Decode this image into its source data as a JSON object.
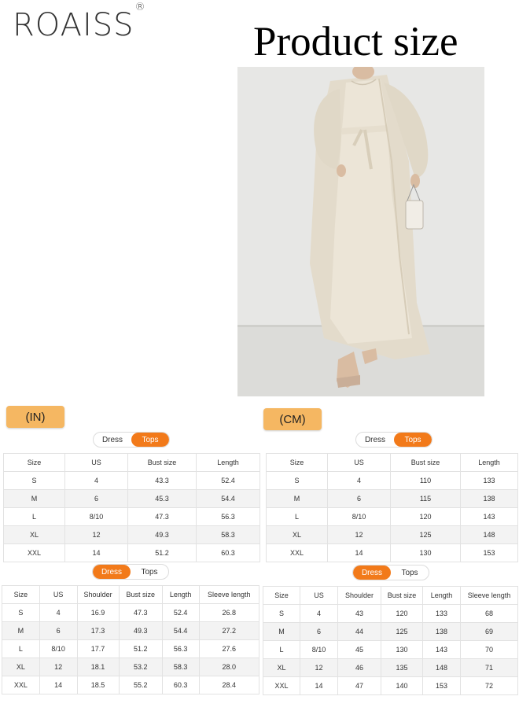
{
  "brand": {
    "name": "ROAISS",
    "mark": "®"
  },
  "title": "Product size",
  "image": {
    "alt": "model wearing long cream abaya dress with open cardigan and tie belt"
  },
  "units": {
    "in": "(IN)",
    "cm": "(CM)"
  },
  "toggle": {
    "dress": "Dress",
    "tops": "Tops"
  },
  "tops_in": {
    "headers": [
      "Size",
      "US",
      "Bust size",
      "Length"
    ],
    "rows": [
      [
        "S",
        "4",
        "43.3",
        "52.4"
      ],
      [
        "M",
        "6",
        "45.3",
        "54.4"
      ],
      [
        "L",
        "8/10",
        "47.3",
        "56.3"
      ],
      [
        "XL",
        "12",
        "49.3",
        "58.3"
      ],
      [
        "XXL",
        "14",
        "51.2",
        "60.3"
      ]
    ]
  },
  "tops_cm": {
    "headers": [
      "Size",
      "US",
      "Bust size",
      "Length"
    ],
    "rows": [
      [
        "S",
        "4",
        "110",
        "133"
      ],
      [
        "M",
        "6",
        "115",
        "138"
      ],
      [
        "L",
        "8/10",
        "120",
        "143"
      ],
      [
        "XL",
        "12",
        "125",
        "148"
      ],
      [
        "XXL",
        "14",
        "130",
        "153"
      ]
    ]
  },
  "dress_in": {
    "headers": [
      "Size",
      "US",
      "Shoulder",
      "Bust size",
      "Length",
      "Sleeve length"
    ],
    "rows": [
      [
        "S",
        "4",
        "16.9",
        "47.3",
        "52.4",
        "26.8"
      ],
      [
        "M",
        "6",
        "17.3",
        "49.3",
        "54.4",
        "27.2"
      ],
      [
        "L",
        "8/10",
        "17.7",
        "51.2",
        "56.3",
        "27.6"
      ],
      [
        "XL",
        "12",
        "18.1",
        "53.2",
        "58.3",
        "28.0"
      ],
      [
        "XXL",
        "14",
        "18.5",
        "55.2",
        "60.3",
        "28.4"
      ]
    ]
  },
  "dress_cm": {
    "headers": [
      "Size",
      "US",
      "Shoulder",
      "Bust size",
      "Length",
      "Sleeve length"
    ],
    "rows": [
      [
        "S",
        "4",
        "43",
        "120",
        "133",
        "68"
      ],
      [
        "M",
        "6",
        "44",
        "125",
        "138",
        "69"
      ],
      [
        "L",
        "8/10",
        "45",
        "130",
        "143",
        "70"
      ],
      [
        "XL",
        "12",
        "46",
        "135",
        "148",
        "71"
      ],
      [
        "XXL",
        "14",
        "47",
        "140",
        "153",
        "72"
      ]
    ]
  },
  "colors": {
    "badge": "#f5b762",
    "active": "#f27a1a",
    "dress": "#ece5d7"
  }
}
